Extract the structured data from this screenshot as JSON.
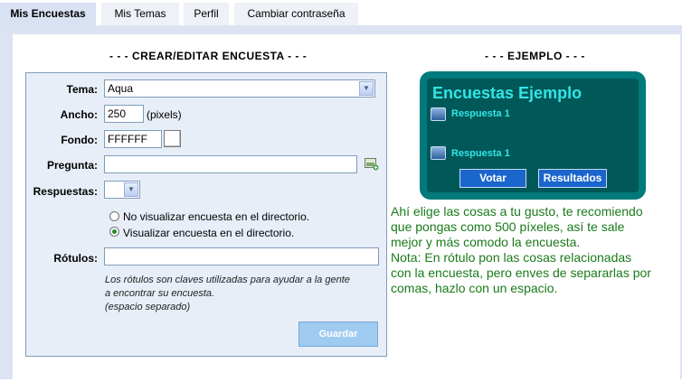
{
  "tabs": [
    {
      "label": "Mis Encuestas",
      "active": true
    },
    {
      "label": "Mis Temas",
      "active": false
    },
    {
      "label": "Perfil",
      "active": false
    },
    {
      "label": "Cambiar contraseña",
      "active": false
    }
  ],
  "form": {
    "section_title": "- - - CREAR/EDITAR ENCUESTA - - -",
    "theme_label": "Tema:",
    "theme_value": "Aqua",
    "width_label": "Ancho:",
    "width_value": "250",
    "width_unit": "(pixels)",
    "background_label": "Fondo:",
    "background_value": "FFFFFF",
    "question_label": "Pregunta:",
    "question_value": "",
    "answers_label": "Respuestas:",
    "answers_value": "",
    "radio_hide": "No visualizar encuesta en el directorio.",
    "radio_show": "Visualizar encuesta en el directorio.",
    "radio_selected": "show",
    "tags_label": "Rótulos:",
    "tags_value": "",
    "help_lines": [
      "Los rótulos son claves utilizadas para ayudar a la gente",
      "a encontrar su encuesta.",
      "(espacio separado)"
    ],
    "save_label": "Guardar"
  },
  "example": {
    "section_title": "- - - EJEMPLO - - -",
    "title": "Encuestas Ejemplo",
    "options": [
      "Respuesta 1",
      "Respuesta 1"
    ],
    "vote_label": "Votar",
    "results_label": "Resultados"
  },
  "note_lines": [
    "Ahí elige las cosas a tu gusto, te recomiendo",
    "que pongas como 500 píxeles, así te sale",
    "mejor y más comodo la encuesta.",
    "Nota: En rótulo pon las cosas relacionadas",
    "con la encuesta, pero enves de separarlas por",
    "comas, hazlo con un espacio."
  ],
  "colors": {
    "accent": "#1a66cc",
    "note_text": "#1a7a1a",
    "example_title": "#33e5e5"
  }
}
